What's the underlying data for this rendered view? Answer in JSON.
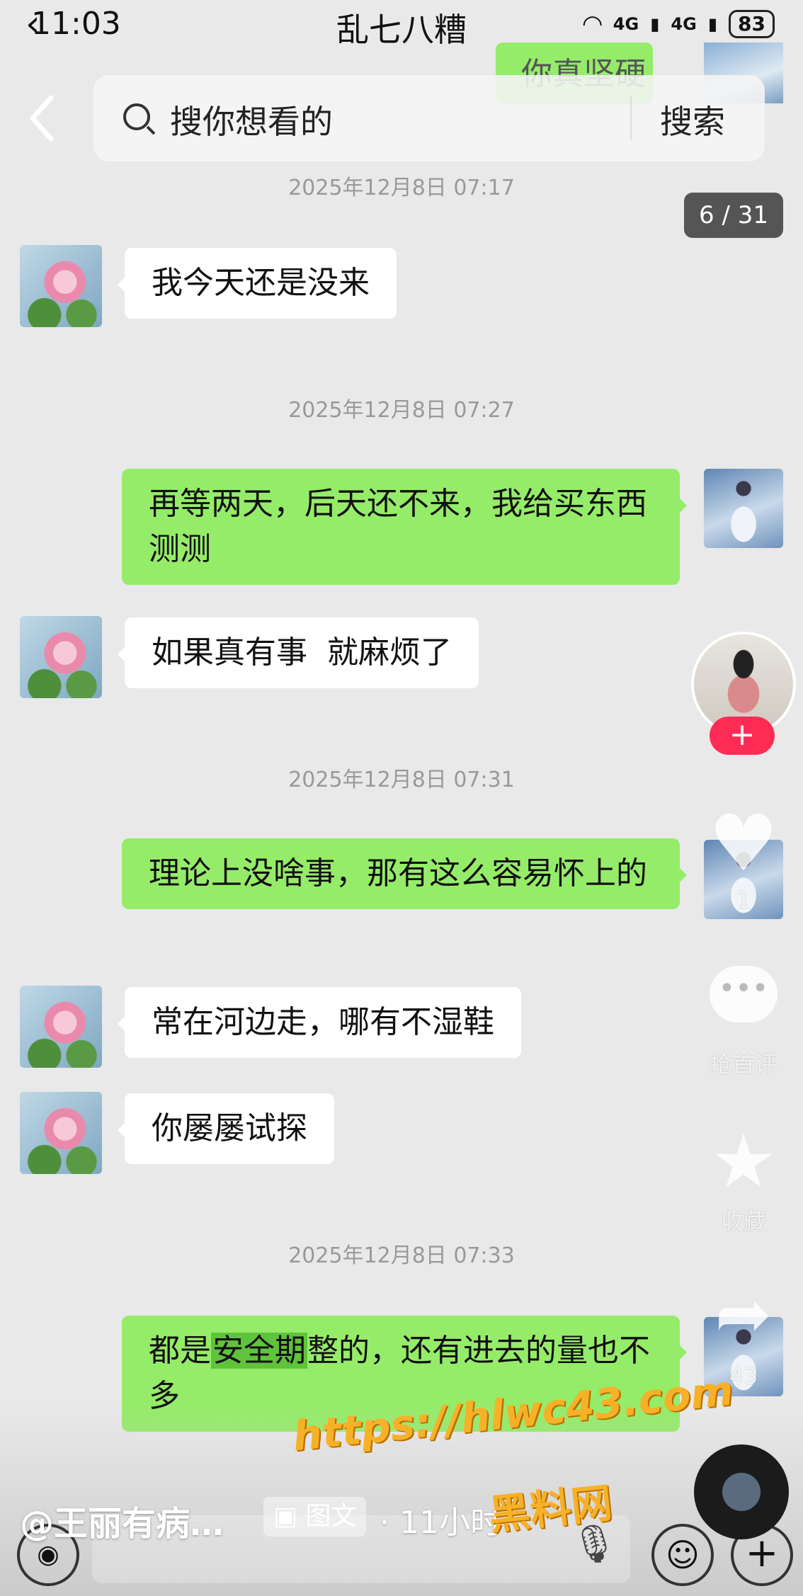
{
  "status": {
    "time": "11:03",
    "title": "乱七八糟",
    "net1": "4G",
    "net2": "4G",
    "battery": "83"
  },
  "search": {
    "placeholder": "搜你想看的",
    "button": "搜索"
  },
  "partial_bubble_text": "你真坚硬",
  "counter": "6 / 31",
  "messages": [
    {
      "type": "time",
      "text": "2025年12月8日 07:17"
    },
    {
      "type": "left",
      "text": "我今天还是没来"
    },
    {
      "type": "time",
      "text": "2025年12月8日 07:27"
    },
    {
      "type": "right",
      "text": "再等两天，后天还不来，我给买东西测测"
    },
    {
      "type": "left",
      "text": "如果真有事  就麻烦了"
    },
    {
      "type": "time",
      "text": "2025年12月8日 07:31"
    },
    {
      "type": "right",
      "text": "理论上没啥事，那有这么容易怀上的"
    },
    {
      "type": "left",
      "text": "常在河边走，哪有不湿鞋"
    },
    {
      "type": "left",
      "text": "你屡屡试探"
    },
    {
      "type": "time",
      "text": "2025年12月8日 07:33"
    },
    {
      "type": "right",
      "pre": "都是",
      "highlight": "安全期",
      "post": "整的，还有进去的量也不多"
    }
  ],
  "side": {
    "like_count": "1",
    "comment_label": "抢首评",
    "comment_dots": "•••",
    "favorite_label": "收藏",
    "share_count": "43",
    "follow_symbol": "+"
  },
  "footer": {
    "author": "@王丽有病…",
    "tag": "图文",
    "time_ago": "· 11小时",
    "watermark_url": "https://hlwc43.com",
    "watermark_name": "黑料网"
  }
}
